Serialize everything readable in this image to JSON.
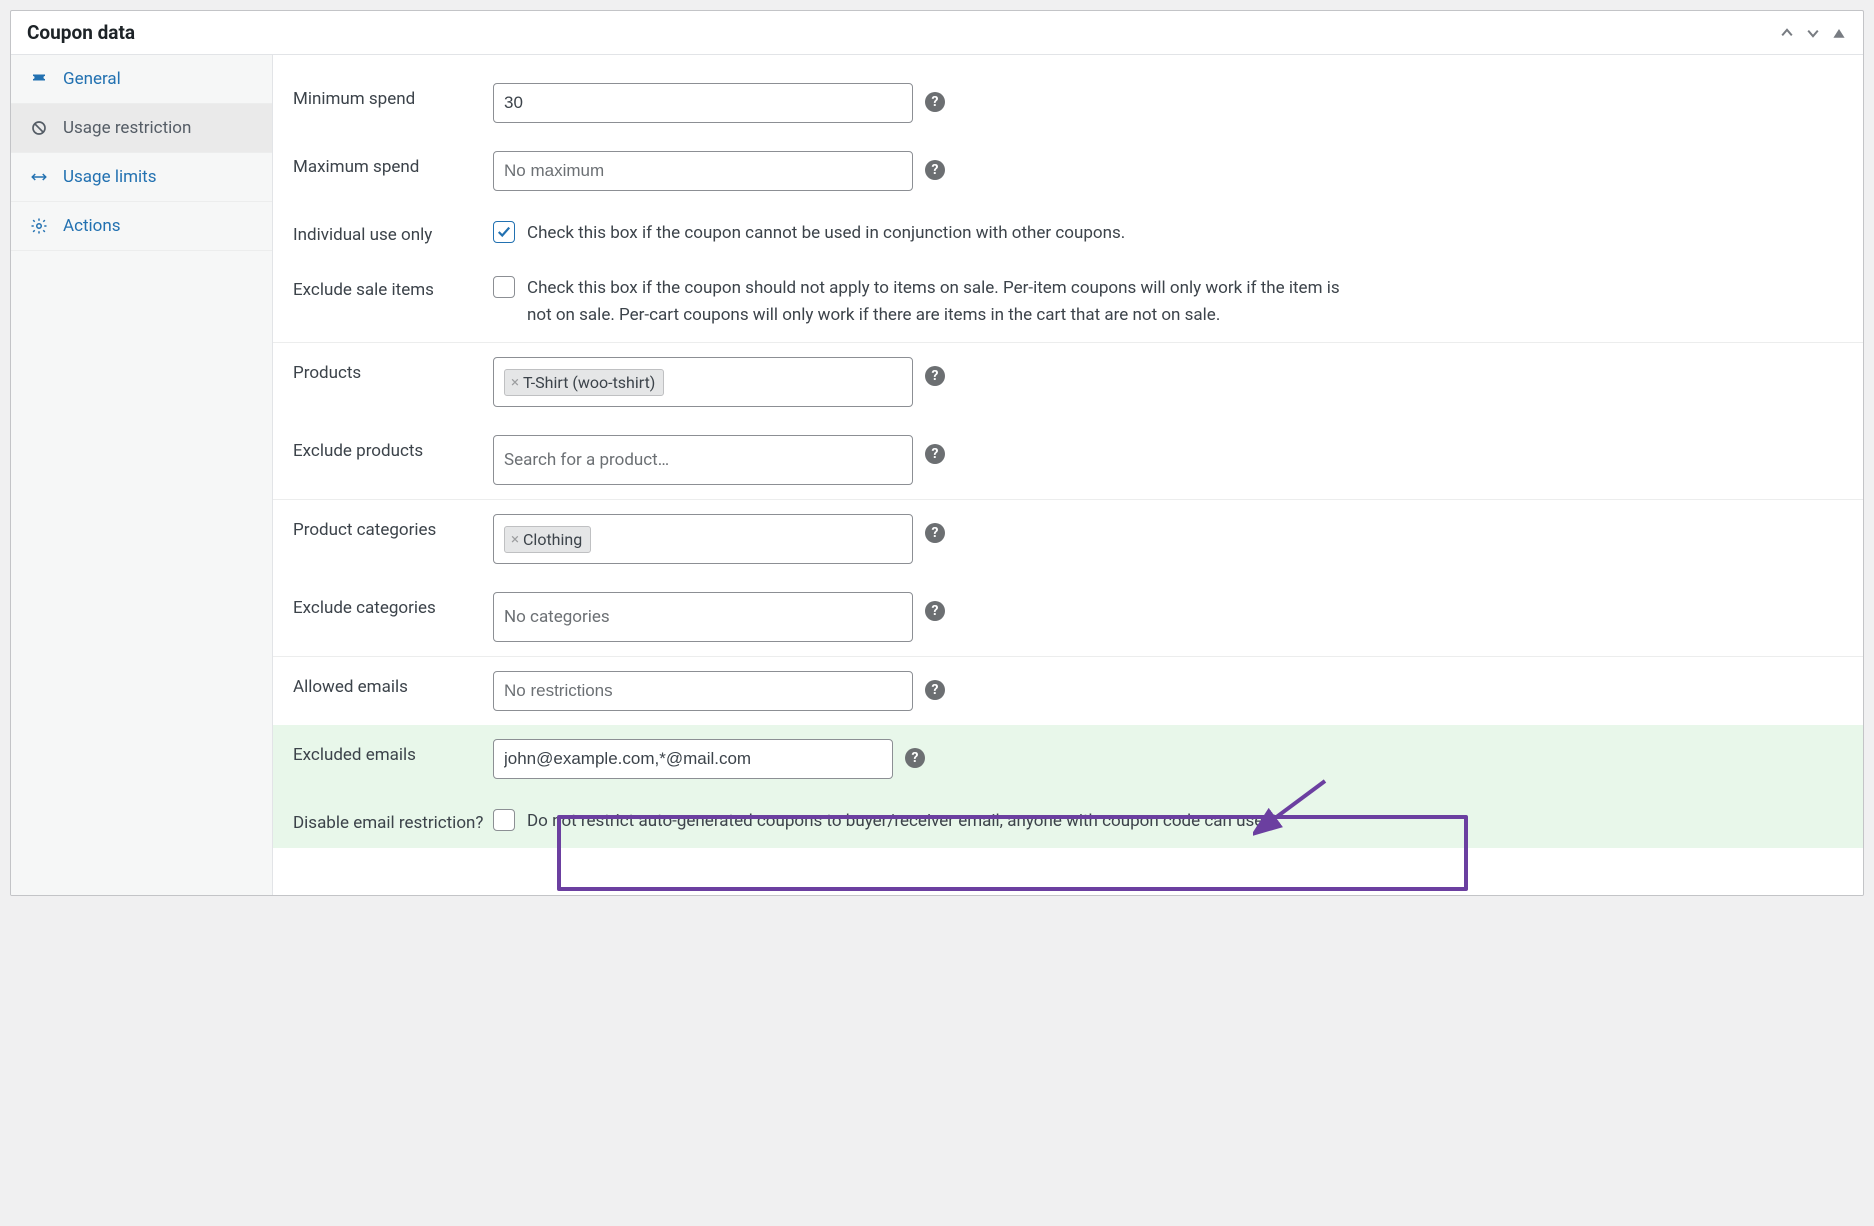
{
  "panel": {
    "title": "Coupon data"
  },
  "tabs": [
    {
      "id": "general",
      "label": "General"
    },
    {
      "id": "usage-restriction",
      "label": "Usage restriction"
    },
    {
      "id": "usage-limits",
      "label": "Usage limits"
    },
    {
      "id": "actions",
      "label": "Actions"
    }
  ],
  "fields": {
    "minimum_spend": {
      "label": "Minimum spend",
      "value": "30"
    },
    "maximum_spend": {
      "label": "Maximum spend",
      "placeholder": "No maximum",
      "value": ""
    },
    "individual_use": {
      "label": "Individual use only",
      "text": "Check this box if the coupon cannot be used in conjunction with other coupons.",
      "checked": true
    },
    "exclude_sale": {
      "label": "Exclude sale items",
      "text": "Check this box if the coupon should not apply to items on sale. Per-item coupons will only work if the item is not on sale. Per-cart coupons will only work if there are items in the cart that are not on sale.",
      "checked": false
    },
    "products": {
      "label": "Products",
      "selected": [
        "T-Shirt (woo-tshirt)"
      ]
    },
    "exclude_products": {
      "label": "Exclude products",
      "placeholder": "Search for a product…"
    },
    "product_categories": {
      "label": "Product categories",
      "selected": [
        "Clothing"
      ]
    },
    "exclude_categories": {
      "label": "Exclude categories",
      "placeholder": "No categories"
    },
    "allowed_emails": {
      "label": "Allowed emails",
      "placeholder": "No restrictions",
      "value": ""
    },
    "excluded_emails": {
      "label": "Excluded emails",
      "value": "john@example.com,*@mail.com"
    },
    "disable_email_restriction": {
      "label": "Disable email restriction?",
      "text": "Do not restrict auto-generated coupons to buyer/receiver email, anyone with coupon code can use it",
      "checked": false
    }
  }
}
